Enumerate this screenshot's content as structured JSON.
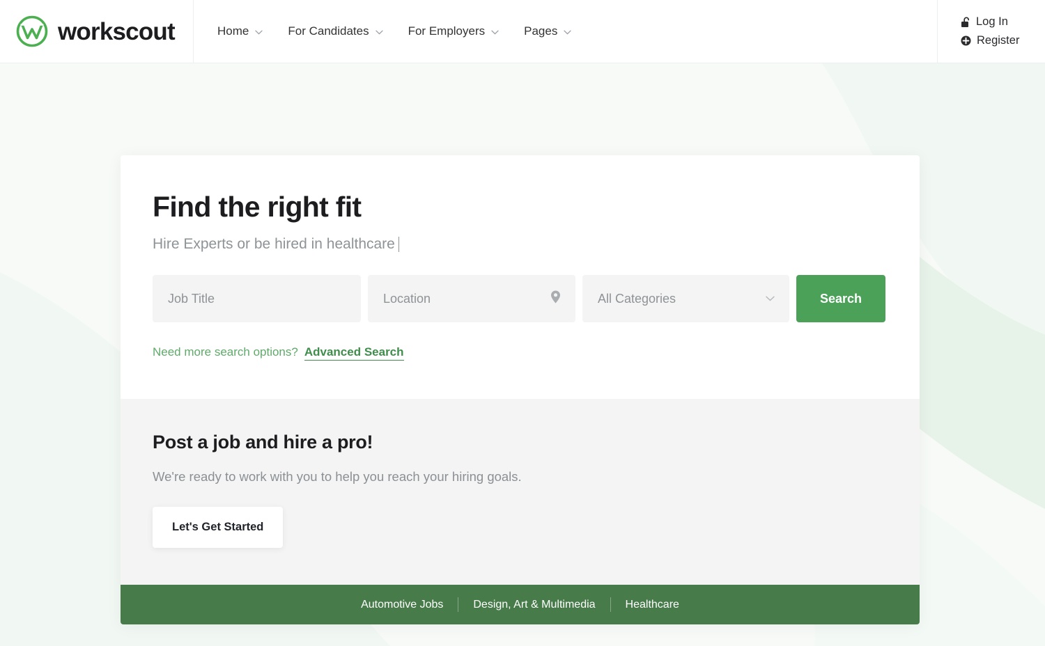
{
  "header": {
    "logo": {
      "icon": "workscout-w-circle-logo",
      "text": "workscout",
      "color": "#4caf50"
    },
    "nav": [
      {
        "label": "Home",
        "icon": "chevron-down-icon"
      },
      {
        "label": "For Candidates",
        "icon": "chevron-down-icon"
      },
      {
        "label": "For Employers",
        "icon": "chevron-down-icon"
      },
      {
        "label": "Pages",
        "icon": "chevron-down-icon"
      }
    ],
    "user": {
      "login_label": "Log In",
      "login_icon": "unlock-icon",
      "register_label": "Register",
      "register_icon": "plus-circle-icon"
    }
  },
  "hero": {
    "title": "Find the right fit",
    "subtitle": "Hire Experts or be hired in healthcare",
    "search": {
      "job_placeholder": "Job Title",
      "job_value": "",
      "location_placeholder": "Location",
      "location_value": "",
      "location_icon": "map-pin-icon",
      "category_selected": "All Categories",
      "category_icon": "chevron-down-icon",
      "button_label": "Search",
      "button_color": "#4ba158"
    },
    "advanced": {
      "question": "Need more search options?",
      "link_label": "Advanced Search"
    }
  },
  "promo": {
    "title": "Post a job and hire a pro!",
    "text": "We're ready to work with you to help you reach your hiring goals.",
    "button_label": "Let's Get Started"
  },
  "categories_bar": {
    "background": "#477c4a",
    "links": [
      {
        "label": "Automotive Jobs"
      },
      {
        "label": "Design, Art & Multimedia"
      },
      {
        "label": "Healthcare"
      }
    ]
  }
}
